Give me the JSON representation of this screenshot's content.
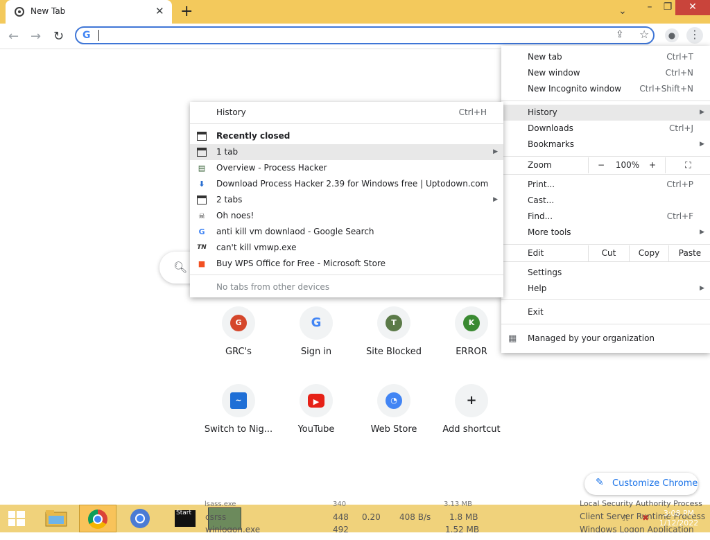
{
  "browser": {
    "tab_title": "New Tab",
    "omnibox_value": "",
    "colors": {
      "accent": "#1a73e8",
      "titlebar": "#f3c95c",
      "taskbar": "#f0d27b"
    }
  },
  "ntp": {
    "tiles": [
      {
        "label": "GRC's",
        "initial": "G",
        "color": "#d5472b",
        "icon": "grc-icon"
      },
      {
        "label": "Sign in",
        "initial": "G",
        "color": "#4285f4",
        "icon": "google-icon"
      },
      {
        "label": "Site Blocked",
        "initial": "T",
        "color": "#5b7a48",
        "icon": "letter-t-icon"
      },
      {
        "label": "ERROR",
        "initial": "K",
        "color": "#3a8a32",
        "icon": "letter-k-icon"
      },
      {
        "label": "Switch to Nig...",
        "initial": "~",
        "color": "#1f6fd6",
        "icon": "nightly-icon"
      },
      {
        "label": "YouTube",
        "initial": "▶",
        "color": "#e62117",
        "icon": "youtube-icon"
      },
      {
        "label": "Web Store",
        "initial": "◔",
        "color": "#4285f4",
        "icon": "webstore-icon"
      },
      {
        "label": "Add shortcut",
        "initial": "+",
        "color": "#202124",
        "icon": "plus-icon"
      }
    ],
    "customize_label": "Customize Chrome"
  },
  "menu": {
    "new_tab": {
      "label": "New tab",
      "shortcut": "Ctrl+T"
    },
    "new_window": {
      "label": "New window",
      "shortcut": "Ctrl+N"
    },
    "new_incognito": {
      "label": "New Incognito window",
      "shortcut": "Ctrl+Shift+N"
    },
    "history": {
      "label": "History"
    },
    "downloads": {
      "label": "Downloads",
      "shortcut": "Ctrl+J"
    },
    "bookmarks": {
      "label": "Bookmarks"
    },
    "zoom": {
      "label": "Zoom",
      "minus": "−",
      "value": "100%",
      "plus": "+"
    },
    "print": {
      "label": "Print...",
      "shortcut": "Ctrl+P"
    },
    "cast": {
      "label": "Cast..."
    },
    "find": {
      "label": "Find...",
      "shortcut": "Ctrl+F"
    },
    "more_tools": {
      "label": "More tools"
    },
    "edit": {
      "label": "Edit",
      "cut": "Cut",
      "copy": "Copy",
      "paste": "Paste"
    },
    "settings": {
      "label": "Settings"
    },
    "help": {
      "label": "Help"
    },
    "exit": {
      "label": "Exit"
    },
    "managed": {
      "label": "Managed by your organization"
    }
  },
  "history_submenu": {
    "history": {
      "label": "History",
      "shortcut": "Ctrl+H"
    },
    "recently_closed": "Recently closed",
    "items": [
      {
        "label": "1 tab",
        "icon": "window-icon",
        "arrow": true
      },
      {
        "label": "Overview - Process Hacker",
        "icon": "process-hacker-icon",
        "arrow": false
      },
      {
        "label": "Download Process Hacker 2.39 for Windows free | Uptodown.com",
        "icon": "uptodown-icon",
        "arrow": false
      },
      {
        "label": "2 tabs",
        "icon": "window-icon",
        "arrow": true
      },
      {
        "label": "Oh noes!",
        "icon": "skull-icon",
        "arrow": false
      },
      {
        "label": "anti kill vm downlaod - Google Search",
        "icon": "google-icon",
        "arrow": false
      },
      {
        "label": "can't kill vmwp.exe",
        "icon": "tn-icon",
        "arrow": false
      },
      {
        "label": "Buy WPS Office for Free - Microsoft Store",
        "icon": "microsoft-icon",
        "arrow": false
      }
    ],
    "no_tabs": "No tabs from other devices"
  },
  "taskbar": {
    "start_label": "Start",
    "bg_process": {
      "name": "csrss",
      "cpu": "0.20",
      "io": "408 B/s",
      "mem": "1.8 MB",
      "desc": "Client Server Runtime Process",
      "pid": "448"
    },
    "bg_row_top": {
      "pid": "340",
      "mem": "3.13 MB",
      "desc": "Local Security Authority Process",
      "name": "lsass.exe"
    },
    "bg_row_bottom": {
      "name": "winlogon.exe",
      "pid": "492",
      "mem": "1.52 MB",
      "desc": "Windows Logon Application"
    },
    "time": "3:08 PM",
    "date": "1/12/2022"
  }
}
